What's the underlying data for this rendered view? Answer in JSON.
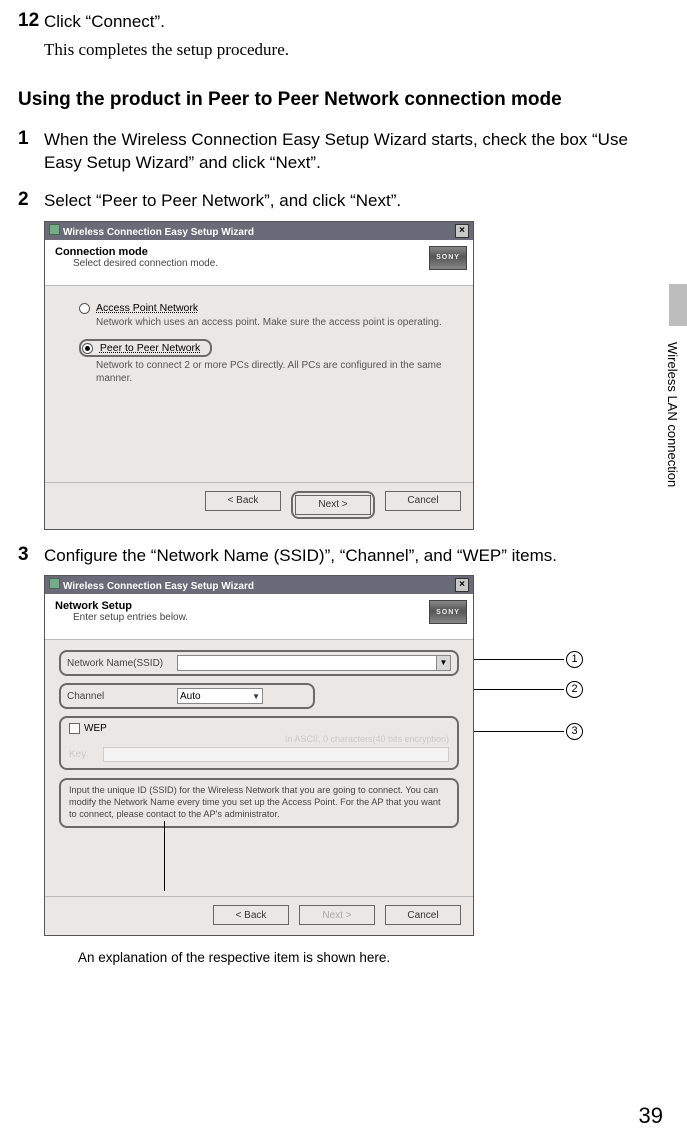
{
  "step12": {
    "num": "12",
    "text": "Click “Connect”."
  },
  "step12_complete": "This completes the setup procedure.",
  "section_heading": "Using the product in Peer to Peer Network connection mode",
  "side_label": "Wireless LAN connection",
  "step1": {
    "num": "1",
    "text": "When the Wireless Connection Easy Setup Wizard starts, check the box “Use Easy Setup Wizard” and click “Next”."
  },
  "step2": {
    "num": "2",
    "text": "Select “Peer to Peer Network”, and click “Next”."
  },
  "dlg1": {
    "title": "Wireless Connection Easy Setup Wizard",
    "logo": "SONY",
    "header1": "Connection mode",
    "header2": "Select desired connection mode.",
    "opt1_label": "Access Point Network",
    "opt1_desc": "Network which uses an access point. Make sure the access point is operating.",
    "opt2_label": "Peer to Peer Network",
    "opt2_desc": "Network to connect 2 or more PCs directly. All PCs are configured in the same manner.",
    "btn_back": "< Back",
    "btn_next": "Next >",
    "btn_cancel": "Cancel"
  },
  "step3": {
    "num": "3",
    "text": "Configure the “Network Name (SSID)”, “Channel”, and “WEP” items."
  },
  "dlg2": {
    "title": "Wireless Connection Easy Setup Wizard",
    "logo": "SONY",
    "header1": "Network Setup",
    "header2": "Enter setup entries below.",
    "ssid_label": "Network Name(SSID)",
    "channel_label": "Channel",
    "channel_value": "Auto",
    "wep_label": "WEP",
    "wep_hint": "In ASCII, 0 characters(40 bits encryption)",
    "key_label": "Key",
    "info_text": "Input the unique ID (SSID) for the Wireless Network that you are going to connect. You can modify the Network Name every time you set up the Access Point. For the AP that you want to connect, please contact to the AP's administrator.",
    "btn_back": "< Back",
    "btn_next": "Next >",
    "btn_cancel": "Cancel"
  },
  "callouts": {
    "c1": "1",
    "c2": "2",
    "c3": "3"
  },
  "fig_caption": "An explanation of the respective item is shown here.",
  "page_number": "39"
}
